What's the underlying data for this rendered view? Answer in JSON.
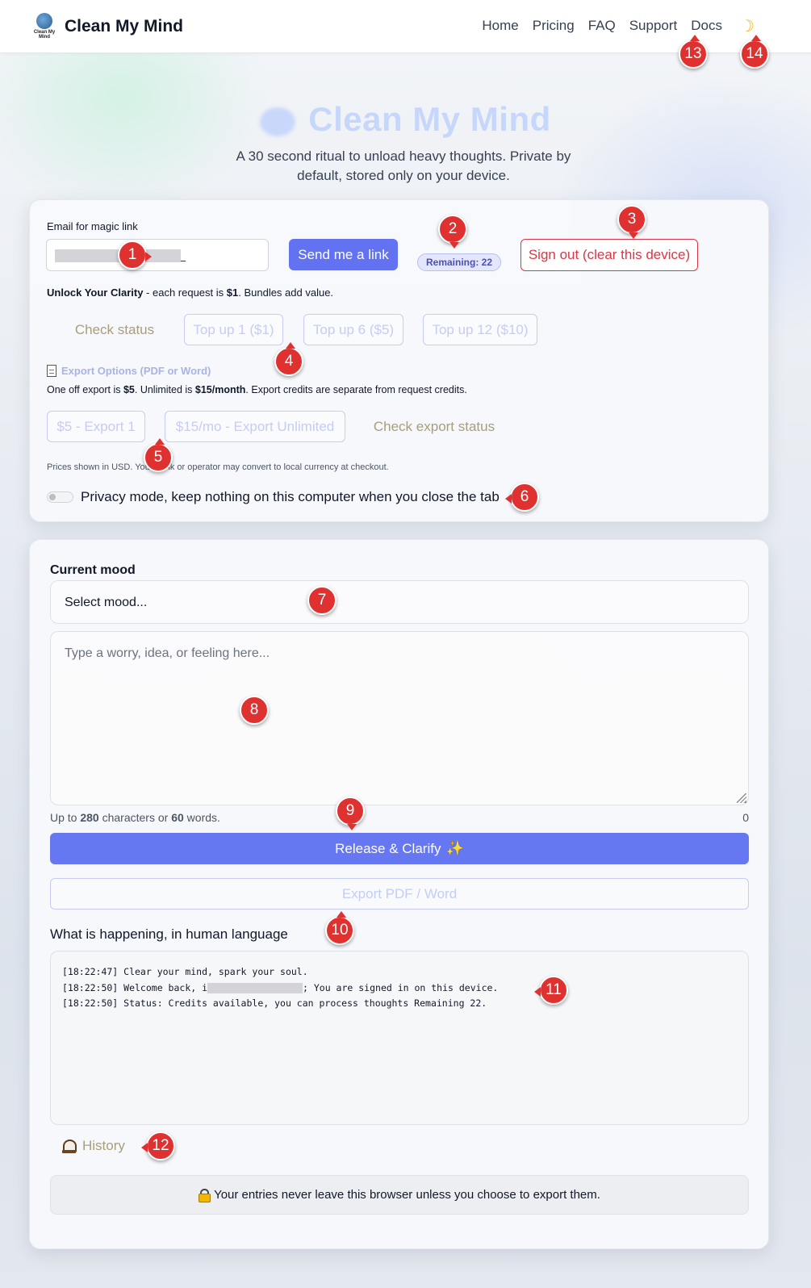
{
  "nav": {
    "brand": "Clean My Mind",
    "logo_caption": "Clean My Mind",
    "links": [
      "Home",
      "Pricing",
      "FAQ",
      "Support",
      "Docs"
    ],
    "theme_icon": "moon-icon"
  },
  "hero": {
    "title": "Clean My Mind",
    "subtitle": "A 30 second ritual to unload heavy thoughts. Private by default, stored only on your device."
  },
  "account": {
    "email_label": "Email for magic link",
    "send_link_label": "Send me a link",
    "remaining_label": "Remaining: 22",
    "sign_out_label": "Sign out (clear this device)",
    "unlock_bold": "Unlock Your Clarity",
    "unlock_mid": " - each request is ",
    "unlock_price": "$1",
    "unlock_tail": ". Bundles add value.",
    "check_status_label": "Check status",
    "topups": [
      "Top up 1 ($1)",
      "Top up 6 ($5)",
      "Top up 12 ($10)"
    ]
  },
  "export": {
    "title": "Export Options (PDF or Word)",
    "desc_1": "One off export is ",
    "desc_price_1": "$5",
    "desc_2": ". Unlimited is ",
    "desc_price_2": "$15/month",
    "desc_3": ". Export credits are separate from request credits.",
    "buttons": [
      "$5 - Export 1",
      "$15/mo - Export Unlimited"
    ],
    "check_label": "Check export status",
    "price_note": "Prices shown in USD. Your bank or operator may convert to local currency at checkout."
  },
  "privacy": {
    "label": "Privacy mode, keep nothing on this computer when you close the tab",
    "enabled": false
  },
  "composer": {
    "mood_label": "Current mood",
    "mood_value": "Select mood...",
    "placeholder": "Type a worry, idea, or feeling here...",
    "limit_1": "Up to ",
    "limit_chars": "280",
    "limit_2": " characters or ",
    "limit_words": "60",
    "limit_3": " words.",
    "count": "0",
    "release_label": "Release & Clarify",
    "export_label": "Export PDF / Word"
  },
  "log": {
    "title": "What is happening, in human language",
    "lines": [
      "[18:22:47] Clear your mind, spark your soul.",
      "[18:22:50] Welcome back, i",
      "; You are signed in on this device.",
      "[18:22:50] Status: Credits available, you can process thoughts Remaining 22."
    ]
  },
  "history_label": "History",
  "footer_note": "Your entries never leave this browser unless you choose to export them.",
  "markers": [
    "1",
    "2",
    "3",
    "4",
    "5",
    "6",
    "7",
    "8",
    "9",
    "10",
    "11",
    "12",
    "13",
    "14"
  ],
  "colors": {
    "primary": "#6272f1",
    "danger": "#dc3545",
    "marker": "#e03131",
    "muted_gold": "#a89e7b"
  }
}
